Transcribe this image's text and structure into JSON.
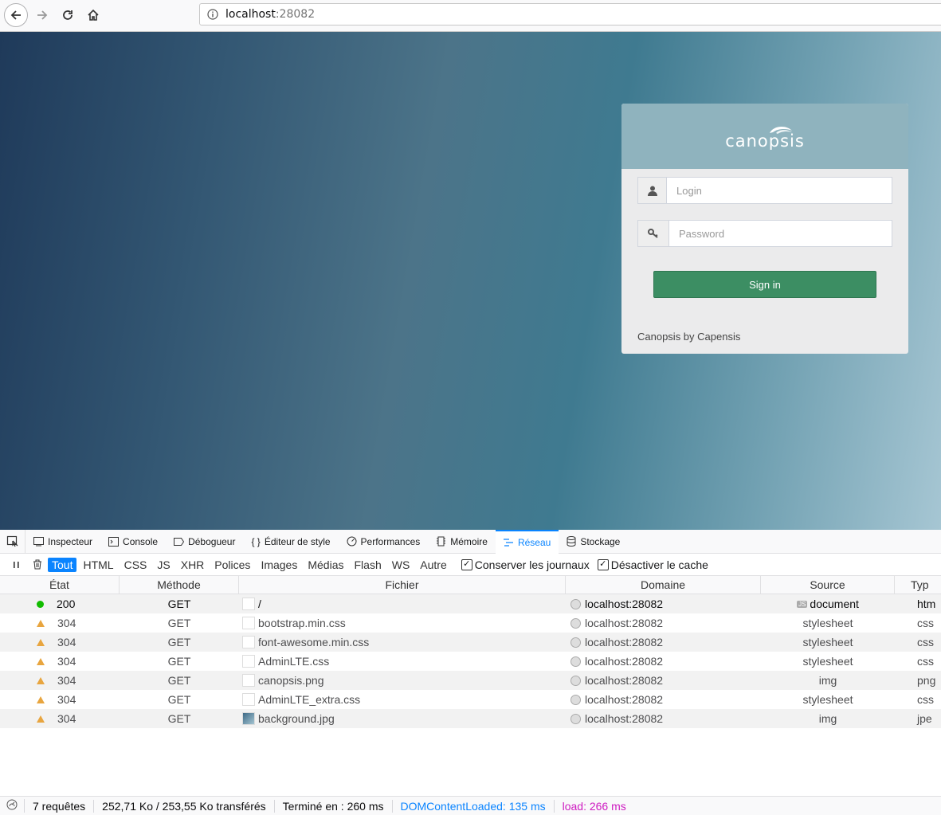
{
  "browser": {
    "url_host": "localhost",
    "url_port": ":28082"
  },
  "login": {
    "logo_text": "canopsis",
    "login_placeholder": "Login",
    "password_placeholder": "Password",
    "signin_label": "Sign in",
    "footer": "Canopsis by Capensis"
  },
  "devtools": {
    "tabs": [
      {
        "label": "Inspecteur"
      },
      {
        "label": "Console"
      },
      {
        "label": "Débogueur"
      },
      {
        "label": "Éditeur de style"
      },
      {
        "label": "Performances"
      },
      {
        "label": "Mémoire"
      },
      {
        "label": "Réseau"
      },
      {
        "label": "Stockage"
      }
    ],
    "active_tab": "Réseau",
    "filters": [
      "Tout",
      "HTML",
      "CSS",
      "JS",
      "XHR",
      "Polices",
      "Images",
      "Médias",
      "Flash",
      "WS",
      "Autre"
    ],
    "active_filter": "Tout",
    "checkboxes": {
      "persist_logs": "Conserver les journaux",
      "disable_cache": "Désactiver le cache"
    },
    "columns": {
      "state": "État",
      "method": "Méthode",
      "file": "Fichier",
      "domain": "Domaine",
      "source": "Source",
      "type": "Typ"
    },
    "requests": [
      {
        "status": "200",
        "method": "GET",
        "file": "/",
        "domain": "localhost:28082",
        "source": "document",
        "type": "htm"
      },
      {
        "status": "304",
        "method": "GET",
        "file": "bootstrap.min.css",
        "domain": "localhost:28082",
        "source": "stylesheet",
        "type": "css"
      },
      {
        "status": "304",
        "method": "GET",
        "file": "font-awesome.min.css",
        "domain": "localhost:28082",
        "source": "stylesheet",
        "type": "css"
      },
      {
        "status": "304",
        "method": "GET",
        "file": "AdminLTE.css",
        "domain": "localhost:28082",
        "source": "stylesheet",
        "type": "css"
      },
      {
        "status": "304",
        "method": "GET",
        "file": "canopsis.png",
        "domain": "localhost:28082",
        "source": "img",
        "type": "png"
      },
      {
        "status": "304",
        "method": "GET",
        "file": "AdminLTE_extra.css",
        "domain": "localhost:28082",
        "source": "stylesheet",
        "type": "css"
      },
      {
        "status": "304",
        "method": "GET",
        "file": "background.jpg",
        "domain": "localhost:28082",
        "source": "img",
        "type": "jpe"
      }
    ],
    "status_bar": {
      "count": "7 requêtes",
      "size": "252,71 Ko / 253,55 Ko transférés",
      "finished": "Terminé en : 260 ms",
      "dcl": "DOMContentLoaded: 135 ms",
      "load": "load: 266 ms"
    }
  }
}
